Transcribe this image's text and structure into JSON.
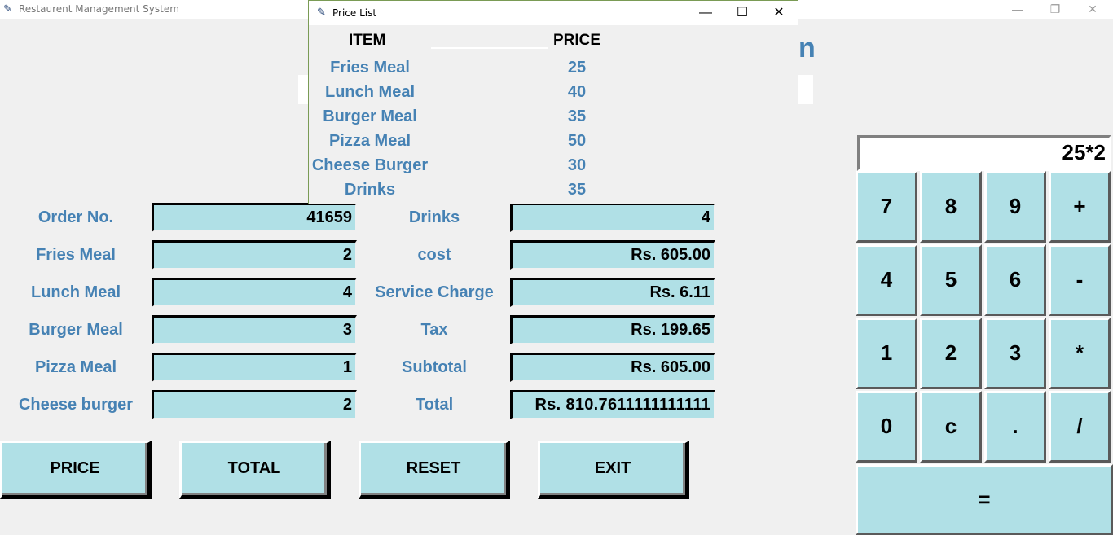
{
  "window": {
    "title": "Restaurent Management System",
    "minimize": "—",
    "maximize": "❐",
    "close": "✕"
  },
  "form": {
    "left": [
      {
        "label": "Order No.",
        "value": "41659"
      },
      {
        "label": "Fries Meal",
        "value": "2"
      },
      {
        "label": "Lunch Meal",
        "value": "4"
      },
      {
        "label": "Burger Meal",
        "value": "3"
      },
      {
        "label": "Pizza Meal",
        "value": "1"
      },
      {
        "label": "Cheese burger",
        "value": "2"
      }
    ],
    "right": [
      {
        "label": "Drinks",
        "value": "4"
      },
      {
        "label": "cost",
        "value": "Rs. 605.00"
      },
      {
        "label": "Service Charge",
        "value": "Rs. 6.11"
      },
      {
        "label": "Tax",
        "value": "Rs. 199.65"
      },
      {
        "label": "Subtotal",
        "value": "Rs. 605.00"
      },
      {
        "label": "Total",
        "value": "Rs. 810.7611111111111"
      }
    ]
  },
  "actions": {
    "price": "PRICE",
    "total": "TOTAL",
    "reset": "RESET",
    "exit": "EXIT"
  },
  "calculator": {
    "display": "25*2",
    "keys": [
      "7",
      "8",
      "9",
      "+",
      "4",
      "5",
      "6",
      "-",
      "1",
      "2",
      "3",
      "*",
      "0",
      "c",
      ".",
      "/"
    ],
    "equals": "="
  },
  "price_list": {
    "title": "Price List",
    "header_item": "ITEM",
    "header_price": "PRICE",
    "rows": [
      {
        "item": "Fries Meal",
        "price": "25"
      },
      {
        "item": "Lunch Meal",
        "price": "40"
      },
      {
        "item": "Burger Meal",
        "price": "35"
      },
      {
        "item": "Pizza Meal",
        "price": "50"
      },
      {
        "item": "Cheese Burger",
        "price": "30"
      },
      {
        "item": "Drinks",
        "price": "35"
      }
    ]
  },
  "colors": {
    "label": "#4682b4",
    "entry_bg": "#b0e0e6",
    "background": "#f0f0f0"
  }
}
